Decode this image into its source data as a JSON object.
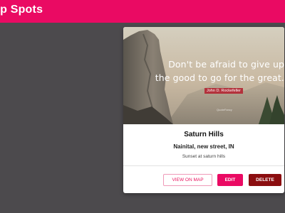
{
  "header": {
    "title": "ap Spots",
    "color": "#ea0a63"
  },
  "card": {
    "image": {
      "quote_line_1": "Don't be afraid to give up",
      "quote_line_2": "the good to go for the great.",
      "author": "John D. Rockefeller",
      "watermark": "QuoteFancy"
    },
    "title": "Saturn Hills",
    "address": "Nainital, new street, IN",
    "description": "Sunset at saturn hills",
    "actions": {
      "view_on_map": "VIEW ON MAP",
      "edit": "EDIT",
      "delete": "DELETE"
    }
  },
  "colors": {
    "accent": "#ea0a63",
    "danger": "#8b0e10",
    "background": "#4c4a4d"
  }
}
